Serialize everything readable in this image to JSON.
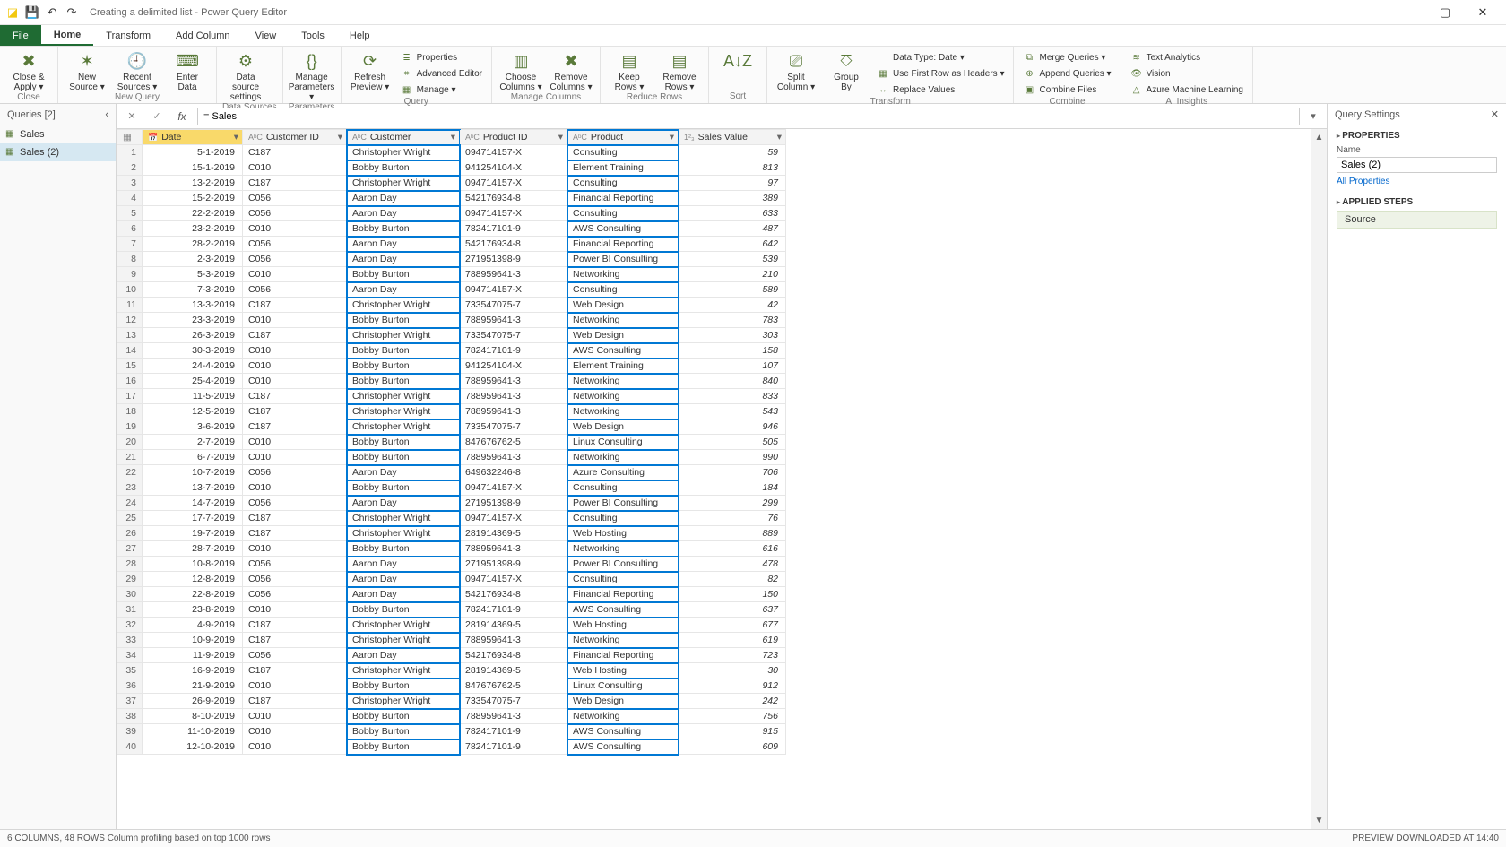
{
  "window": {
    "title": "Creating a delimited list - Power Query Editor"
  },
  "tabs": [
    "File",
    "Home",
    "Transform",
    "Add Column",
    "View",
    "Tools",
    "Help"
  ],
  "activeTab": "Home",
  "ribbon": {
    "groups": [
      {
        "label": "Close",
        "items": [
          {
            "label": "Close &\nApply ▾",
            "icon": "✖"
          }
        ]
      },
      {
        "label": "New Query",
        "items": [
          {
            "label": "New\nSource ▾",
            "icon": "✶"
          },
          {
            "label": "Recent\nSources ▾",
            "icon": "🕘"
          },
          {
            "label": "Enter\nData",
            "icon": "⌨"
          }
        ]
      },
      {
        "label": "Data Sources",
        "items": [
          {
            "label": "Data source\nsettings",
            "icon": "⚙"
          }
        ]
      },
      {
        "label": "Parameters",
        "items": [
          {
            "label": "Manage\nParameters ▾",
            "icon": "{}"
          }
        ]
      },
      {
        "label": "Query",
        "items": [
          {
            "label": "Refresh\nPreview ▾",
            "icon": "⟳"
          }
        ],
        "small": [
          {
            "label": "Properties",
            "icon": "≣"
          },
          {
            "label": "Advanced Editor",
            "icon": "⌗"
          },
          {
            "label": "Manage ▾",
            "icon": "▦"
          }
        ]
      },
      {
        "label": "Manage Columns",
        "items": [
          {
            "label": "Choose\nColumns ▾",
            "icon": "▥"
          },
          {
            "label": "Remove\nColumns ▾",
            "icon": "✖"
          }
        ]
      },
      {
        "label": "Reduce Rows",
        "items": [
          {
            "label": "Keep\nRows ▾",
            "icon": "▤"
          },
          {
            "label": "Remove\nRows ▾",
            "icon": "▤"
          }
        ]
      },
      {
        "label": "Sort",
        "items": [
          {
            "label": "",
            "icon": "A↓Z"
          }
        ]
      },
      {
        "label": "Transform",
        "items": [
          {
            "label": "Split\nColumn ▾",
            "icon": "⎚"
          },
          {
            "label": "Group\nBy",
            "icon": "⎏"
          }
        ],
        "small": [
          {
            "label": "Data Type: Date ▾",
            "icon": ""
          },
          {
            "label": "Use First Row as Headers ▾",
            "icon": "▦"
          },
          {
            "label": "Replace Values",
            "icon": "↔"
          }
        ]
      },
      {
        "label": "Combine",
        "items": [],
        "small": [
          {
            "label": "Merge Queries ▾",
            "icon": "⧉"
          },
          {
            "label": "Append Queries ▾",
            "icon": "⊕"
          },
          {
            "label": "Combine Files",
            "icon": "▣"
          }
        ]
      },
      {
        "label": "AI Insights",
        "items": [],
        "small": [
          {
            "label": "Text Analytics",
            "icon": "≋"
          },
          {
            "label": "Vision",
            "icon": "👁"
          },
          {
            "label": "Azure Machine Learning",
            "icon": "△"
          }
        ]
      }
    ]
  },
  "queriesPane": {
    "title": "Queries [2]",
    "items": [
      "Sales",
      "Sales (2)"
    ],
    "selected": 1
  },
  "formulaBar": {
    "value": "= Sales"
  },
  "columns": [
    {
      "name": "Date",
      "type": "📅",
      "class": "col-date",
      "hl": false,
      "hdrSpecial": true
    },
    {
      "name": "Customer ID",
      "type": "AᵇC",
      "class": "col-custid",
      "hl": false
    },
    {
      "name": "Customer",
      "type": "AᵇC",
      "class": "col-cust",
      "hl": true
    },
    {
      "name": "Product ID",
      "type": "AᵇC",
      "class": "col-prodid",
      "hl": false
    },
    {
      "name": "Product",
      "type": "AᵇC",
      "class": "col-prod",
      "hl": true
    },
    {
      "name": "Sales Value",
      "type": "1²₃",
      "class": "col-val",
      "hl": false
    }
  ],
  "rows": [
    [
      "5-1-2019",
      "C187",
      "Christopher Wright",
      "094714157-X",
      "Consulting",
      "59"
    ],
    [
      "15-1-2019",
      "C010",
      "Bobby Burton",
      "941254104-X",
      "Element Training",
      "813"
    ],
    [
      "13-2-2019",
      "C187",
      "Christopher Wright",
      "094714157-X",
      "Consulting",
      "97"
    ],
    [
      "15-2-2019",
      "C056",
      "Aaron Day",
      "542176934-8",
      "Financial Reporting",
      "389"
    ],
    [
      "22-2-2019",
      "C056",
      "Aaron Day",
      "094714157-X",
      "Consulting",
      "633"
    ],
    [
      "23-2-2019",
      "C010",
      "Bobby Burton",
      "782417101-9",
      "AWS Consulting",
      "487"
    ],
    [
      "28-2-2019",
      "C056",
      "Aaron Day",
      "542176934-8",
      "Financial Reporting",
      "642"
    ],
    [
      "2-3-2019",
      "C056",
      "Aaron Day",
      "271951398-9",
      "Power BI Consulting",
      "539"
    ],
    [
      "5-3-2019",
      "C010",
      "Bobby Burton",
      "788959641-3",
      "Networking",
      "210"
    ],
    [
      "7-3-2019",
      "C056",
      "Aaron Day",
      "094714157-X",
      "Consulting",
      "589"
    ],
    [
      "13-3-2019",
      "C187",
      "Christopher Wright",
      "733547075-7",
      "Web Design",
      "42"
    ],
    [
      "23-3-2019",
      "C010",
      "Bobby Burton",
      "788959641-3",
      "Networking",
      "783"
    ],
    [
      "26-3-2019",
      "C187",
      "Christopher Wright",
      "733547075-7",
      "Web Design",
      "303"
    ],
    [
      "30-3-2019",
      "C010",
      "Bobby Burton",
      "782417101-9",
      "AWS Consulting",
      "158"
    ],
    [
      "24-4-2019",
      "C010",
      "Bobby Burton",
      "941254104-X",
      "Element Training",
      "107"
    ],
    [
      "25-4-2019",
      "C010",
      "Bobby Burton",
      "788959641-3",
      "Networking",
      "840"
    ],
    [
      "11-5-2019",
      "C187",
      "Christopher Wright",
      "788959641-3",
      "Networking",
      "833"
    ],
    [
      "12-5-2019",
      "C187",
      "Christopher Wright",
      "788959641-3",
      "Networking",
      "543"
    ],
    [
      "3-6-2019",
      "C187",
      "Christopher Wright",
      "733547075-7",
      "Web Design",
      "946"
    ],
    [
      "2-7-2019",
      "C010",
      "Bobby Burton",
      "847676762-5",
      "Linux Consulting",
      "505"
    ],
    [
      "6-7-2019",
      "C010",
      "Bobby Burton",
      "788959641-3",
      "Networking",
      "990"
    ],
    [
      "10-7-2019",
      "C056",
      "Aaron Day",
      "649632246-8",
      "Azure Consulting",
      "706"
    ],
    [
      "13-7-2019",
      "C010",
      "Bobby Burton",
      "094714157-X",
      "Consulting",
      "184"
    ],
    [
      "14-7-2019",
      "C056",
      "Aaron Day",
      "271951398-9",
      "Power BI Consulting",
      "299"
    ],
    [
      "17-7-2019",
      "C187",
      "Christopher Wright",
      "094714157-X",
      "Consulting",
      "76"
    ],
    [
      "19-7-2019",
      "C187",
      "Christopher Wright",
      "281914369-5",
      "Web Hosting",
      "889"
    ],
    [
      "28-7-2019",
      "C010",
      "Bobby Burton",
      "788959641-3",
      "Networking",
      "616"
    ],
    [
      "10-8-2019",
      "C056",
      "Aaron Day",
      "271951398-9",
      "Power BI Consulting",
      "478"
    ],
    [
      "12-8-2019",
      "C056",
      "Aaron Day",
      "094714157-X",
      "Consulting",
      "82"
    ],
    [
      "22-8-2019",
      "C056",
      "Aaron Day",
      "542176934-8",
      "Financial Reporting",
      "150"
    ],
    [
      "23-8-2019",
      "C010",
      "Bobby Burton",
      "782417101-9",
      "AWS Consulting",
      "637"
    ],
    [
      "4-9-2019",
      "C187",
      "Christopher Wright",
      "281914369-5",
      "Web Hosting",
      "677"
    ],
    [
      "10-9-2019",
      "C187",
      "Christopher Wright",
      "788959641-3",
      "Networking",
      "619"
    ],
    [
      "11-9-2019",
      "C056",
      "Aaron Day",
      "542176934-8",
      "Financial Reporting",
      "723"
    ],
    [
      "16-9-2019",
      "C187",
      "Christopher Wright",
      "281914369-5",
      "Web Hosting",
      "30"
    ],
    [
      "21-9-2019",
      "C010",
      "Bobby Burton",
      "847676762-5",
      "Linux Consulting",
      "912"
    ],
    [
      "26-9-2019",
      "C187",
      "Christopher Wright",
      "733547075-7",
      "Web Design",
      "242"
    ],
    [
      "8-10-2019",
      "C010",
      "Bobby Burton",
      "788959641-3",
      "Networking",
      "756"
    ],
    [
      "11-10-2019",
      "C010",
      "Bobby Burton",
      "782417101-9",
      "AWS Consulting",
      "915"
    ],
    [
      "12-10-2019",
      "C010",
      "Bobby Burton",
      "782417101-9",
      "AWS Consulting",
      "609"
    ]
  ],
  "querySettings": {
    "title": "Query Settings",
    "properties": {
      "title": "PROPERTIES",
      "nameLabel": "Name",
      "name": "Sales (2)",
      "allProps": "All Properties"
    },
    "steps": {
      "title": "APPLIED STEPS",
      "items": [
        "Source"
      ]
    }
  },
  "statusbar": {
    "left": "6 COLUMNS, 48 ROWS     Column profiling based on top 1000 rows",
    "right": "PREVIEW DOWNLOADED AT 14:40"
  }
}
